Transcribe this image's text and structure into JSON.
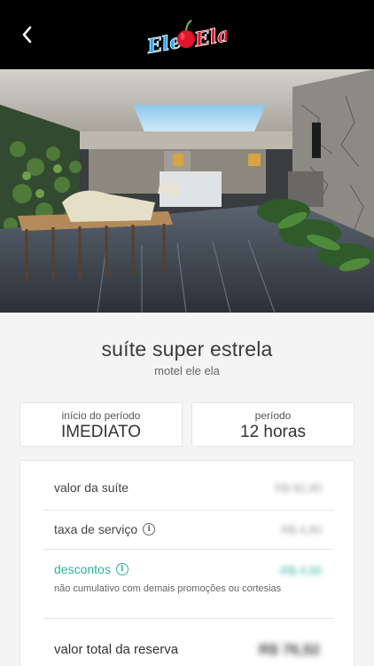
{
  "header": {
    "logo_text_left": "Ele",
    "logo_text_right": "Ela",
    "back_icon": "chevron-left-icon"
  },
  "carousel": {
    "total_slides": 13,
    "active_index": 0
  },
  "suite": {
    "title": "suíte super estrela",
    "motel": "motel ele ela"
  },
  "period_start": {
    "label": "início do período",
    "value": "IMEDIATO"
  },
  "period": {
    "label": "período",
    "value": "12 horas"
  },
  "summary": {
    "suite_value_label": "valor da suíte",
    "suite_value": "R$ 82,90",
    "service_fee_label": "taxa de serviço",
    "service_fee": "R$ 4,90",
    "discounts_label": "descontos",
    "discounts": "-R$ 4,00",
    "discounts_note": "não cumulativo com demais promoções ou cortesias",
    "total_label": "valor total da reserva",
    "total": "R$ 76,52"
  },
  "colors": {
    "header_bg": "#000000",
    "accent_green": "#2db39b",
    "logo_blue": "#1ea7ff",
    "logo_red": "#e0142b"
  }
}
